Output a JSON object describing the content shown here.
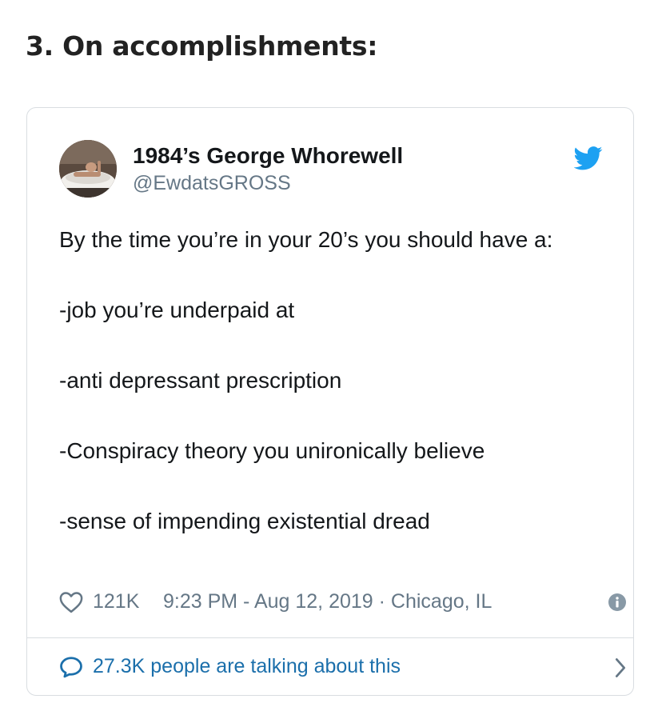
{
  "article": {
    "section_heading": "3. On accomplishments:"
  },
  "tweet": {
    "display_name": "1984’s George Whorewell",
    "handle": "@EwdatsGROSS",
    "text_lines": [
      "By the time you’re in your 20’s you should have a:",
      "-job you’re underpaid at",
      "-anti depressant prescription",
      "-Conspiracy theory you unironically believe",
      "-sense of impending existential dread"
    ],
    "like_count": "121K",
    "timestamp": "9:23 PM - Aug 12, 2019 · Chicago, IL",
    "conversation_label": "27.3K people are talking about this"
  },
  "icons": {
    "avatar": "avatar",
    "brand": "twitter-bird-icon",
    "like": "heart-icon",
    "info": "info-icon",
    "comment": "comment-icon",
    "chevron": "chevron-right-icon"
  },
  "colors": {
    "twitter_blue": "#1da1f2",
    "link_blue": "#1b6fab",
    "secondary_text": "#657786",
    "primary_text": "#14171a",
    "border": "#d9dde1"
  }
}
